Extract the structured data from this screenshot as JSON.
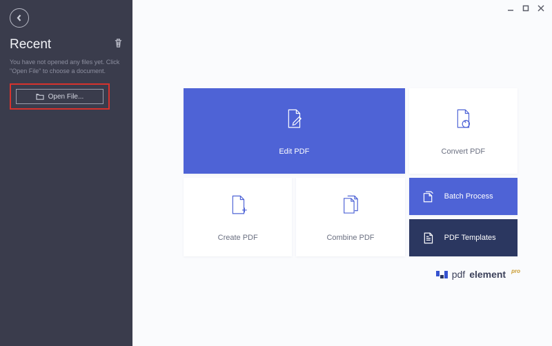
{
  "sidebar": {
    "title": "Recent",
    "hint": "You have not opened any files yet. Click \"Open File\" to choose a document.",
    "open_file_label": "Open File..."
  },
  "tiles": {
    "edit": "Edit PDF",
    "convert": "Convert PDF",
    "create": "Create PDF",
    "combine": "Combine PDF",
    "batch": "Batch Process",
    "templates": "PDF Templates"
  },
  "brand": {
    "light": "pdf",
    "bold": "element",
    "suffix": "pro"
  }
}
